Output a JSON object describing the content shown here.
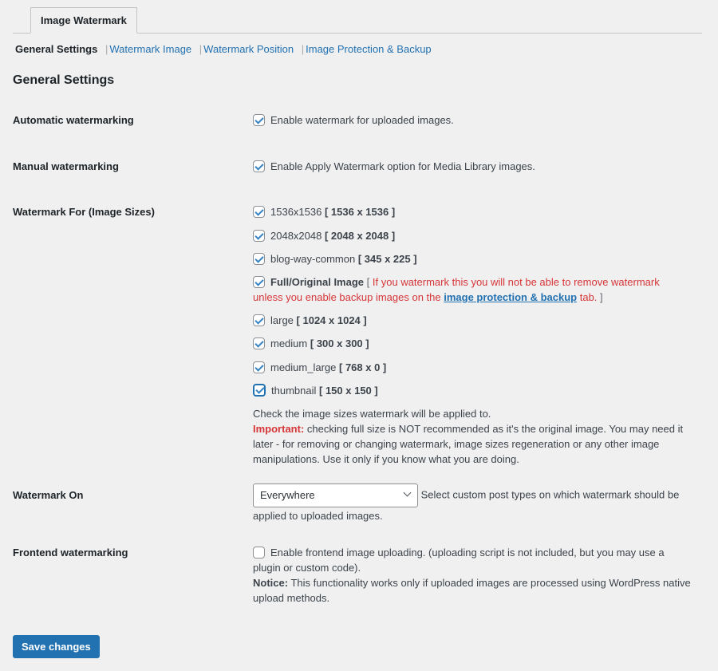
{
  "tab": {
    "label": "Image Watermark"
  },
  "subnav": [
    {
      "label": "General Settings",
      "current": true
    },
    {
      "label": "Watermark Image",
      "current": false
    },
    {
      "label": "Watermark Position",
      "current": false
    },
    {
      "label": "Image Protection & Backup",
      "current": false
    }
  ],
  "section_title": "General Settings",
  "settings": {
    "automatic": {
      "label": "Automatic watermarking",
      "checkbox_label": "Enable watermark for uploaded images.",
      "checked": true
    },
    "manual": {
      "label": "Manual watermarking",
      "checkbox_label": "Enable Apply Watermark option for Media Library images.",
      "checked": true
    },
    "image_sizes": {
      "label": "Watermark For (Image Sizes)",
      "options": [
        {
          "name": "1536x1536",
          "dims": "[ 1536 x 1536 ]",
          "checked": true
        },
        {
          "name": "2048x2048",
          "dims": "[ 2048 x 2048 ]",
          "checked": true
        },
        {
          "name": "blog-way-common",
          "dims": "[ 345 x 225 ]",
          "checked": true
        },
        {
          "name": "Full/Original Image",
          "checked": true
        },
        {
          "name": "large",
          "dims": "[ 1024 x 1024 ]",
          "checked": true
        },
        {
          "name": "medium",
          "dims": "[ 300 x 300 ]",
          "checked": true
        },
        {
          "name": "medium_large",
          "dims": "[ 768 x 0 ]",
          "checked": true
        },
        {
          "name": "thumbnail",
          "dims": "[ 150 x 150 ]",
          "checked": true,
          "focused": true
        }
      ],
      "full_warning_open": "[",
      "full_warning_text": "If you watermark this you will not be able to remove watermark unless you enable backup images on the",
      "full_warning_link": "image protection & backup",
      "full_warning_tail": "tab.",
      "full_warning_close": "]",
      "help_line1": "Check the image sizes watermark will be applied to.",
      "help_important_label": "Important:",
      "help_important_text": "checking full size is NOT recommended as it's the original image. You may need it later - for removing or changing watermark, image sizes regeneration or any other image manipulations. Use it only if you know what you are doing."
    },
    "watermark_on": {
      "label": "Watermark On",
      "selected": "Everywhere",
      "description": "Select custom post types on which watermark should be applied to uploaded images."
    },
    "frontend": {
      "label": "Frontend watermarking",
      "checkbox_label": "Enable frontend image uploading. (uploading script is not included, but you may use a plugin or custom code).",
      "checked": false,
      "notice_label": "Notice:",
      "notice_text": "This functionality works only if uploaded images are processed using WordPress native upload methods."
    }
  },
  "save_button": "Save changes",
  "colors": {
    "accent": "#2271b1",
    "warning": "#d63638",
    "background": "#f0f0f1"
  }
}
